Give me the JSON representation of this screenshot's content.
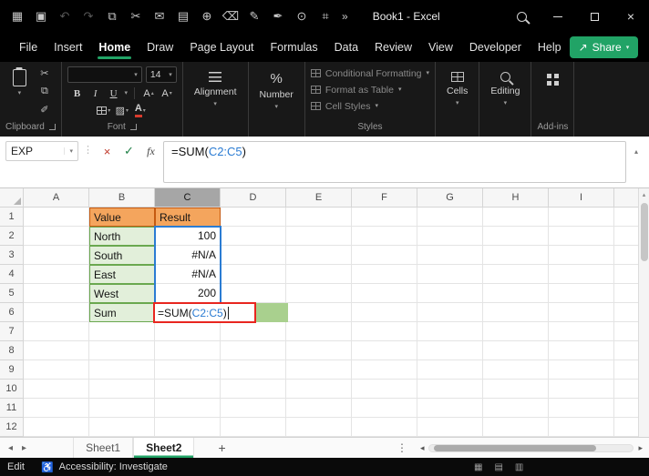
{
  "titlebar": {
    "title": "Book1 - Excel",
    "quick_access": [
      {
        "name": "app-launcher",
        "glyph": "▦",
        "disabled": false
      },
      {
        "name": "save",
        "glyph": "▣",
        "disabled": false
      },
      {
        "name": "undo",
        "glyph": "↶",
        "disabled": true
      },
      {
        "name": "redo",
        "glyph": "↷",
        "disabled": true
      },
      {
        "name": "copy",
        "glyph": "⧉",
        "disabled": false
      },
      {
        "name": "cut",
        "glyph": "✂",
        "disabled": false
      },
      {
        "name": "mail",
        "glyph": "✉",
        "disabled": false
      },
      {
        "name": "print",
        "glyph": "▤",
        "disabled": false
      },
      {
        "name": "globe",
        "glyph": "⊕",
        "disabled": false
      },
      {
        "name": "eraser",
        "glyph": "⌫",
        "disabled": false
      },
      {
        "name": "draw-pen",
        "glyph": "✎",
        "disabled": false
      },
      {
        "name": "ink-pen",
        "glyph": "✒",
        "disabled": false
      },
      {
        "name": "zoom",
        "glyph": "⊙",
        "disabled": false
      },
      {
        "name": "screenshot",
        "glyph": "⌗",
        "disabled": false
      }
    ],
    "more_commands_label": "»",
    "close_glyph": "×"
  },
  "menubar": {
    "items": [
      "File",
      "Insert",
      "Home",
      "Draw",
      "Page Layout",
      "Formulas",
      "Data",
      "Review",
      "View",
      "Developer",
      "Help"
    ],
    "active_item": "Home",
    "share_label": "Share"
  },
  "ribbon": {
    "clipboard": {
      "label": "Clipboard"
    },
    "font": {
      "label": "Font",
      "size_value": "14",
      "bold_label": "B",
      "italic_label": "I",
      "underline_label": "U",
      "font_color_label": "A"
    },
    "alignment": {
      "label": "Alignment"
    },
    "number": {
      "label": "Number",
      "icon_label": "%"
    },
    "styles": {
      "label": "Styles",
      "conditional_formatting_label": "Conditional Formatting",
      "format_as_table_label": "Format as Table",
      "cell_styles_label": "Cell Styles"
    },
    "cells": {
      "label": "Cells"
    },
    "editing": {
      "label": "Editing"
    },
    "addins": {
      "label": "Add-ins"
    }
  },
  "formula_bar": {
    "name_box_value": "EXP",
    "cancel_glyph": "×",
    "enter_glyph": "✓",
    "insert_function_label": "fx"
  },
  "formula": {
    "prefix": "=SUM(",
    "reference": "C2:C5",
    "suffix": ")"
  },
  "grid": {
    "column_headers": [
      "A",
      "B",
      "C",
      "D",
      "E",
      "F",
      "G",
      "H",
      "I"
    ],
    "selected_column": "C",
    "row_headers": [
      "1",
      "2",
      "3",
      "4",
      "5",
      "6",
      "7",
      "8",
      "9",
      "10",
      "11",
      "12"
    ],
    "cells": [
      {
        "ref": "B1",
        "text": "Value",
        "style": "orange"
      },
      {
        "ref": "C1",
        "text": "Result",
        "style": "orange"
      },
      {
        "ref": "B2",
        "text": "North",
        "style": "green"
      },
      {
        "ref": "C2",
        "text": "100",
        "style": "num"
      },
      {
        "ref": "B3",
        "text": "South",
        "style": "green"
      },
      {
        "ref": "C3",
        "text": "#N/A",
        "style": "num"
      },
      {
        "ref": "B4",
        "text": "East",
        "style": "green"
      },
      {
        "ref": "C4",
        "text": "#N/A",
        "style": "num"
      },
      {
        "ref": "B5",
        "text": "West",
        "style": "green"
      },
      {
        "ref": "C5",
        "text": "200",
        "style": "num"
      },
      {
        "ref": "B6",
        "text": "Sum",
        "style": "green"
      }
    ],
    "edit_cell_ref": "C6"
  },
  "sheet_tabs": {
    "tabs": [
      "Sheet1",
      "Sheet2"
    ],
    "active_tab": "Sheet2",
    "add_sheet_label": "+"
  },
  "status_bar": {
    "mode_label": "Edit",
    "accessibility_label": "Accessibility: Investigate"
  },
  "colors": {
    "accent_green": "#21A366",
    "header_fill_orange": "#F4A55D",
    "header_border_orange": "#C55A11",
    "cell_fill_green": "#E2EFDA",
    "cell_border_green": "#6AA84F",
    "range_border_blue": "#2B7CD3",
    "reference_text_blue": "#2B7CD3",
    "edit_border_red": "#E8261F",
    "preview_fill_green": "#A9D08E"
  }
}
